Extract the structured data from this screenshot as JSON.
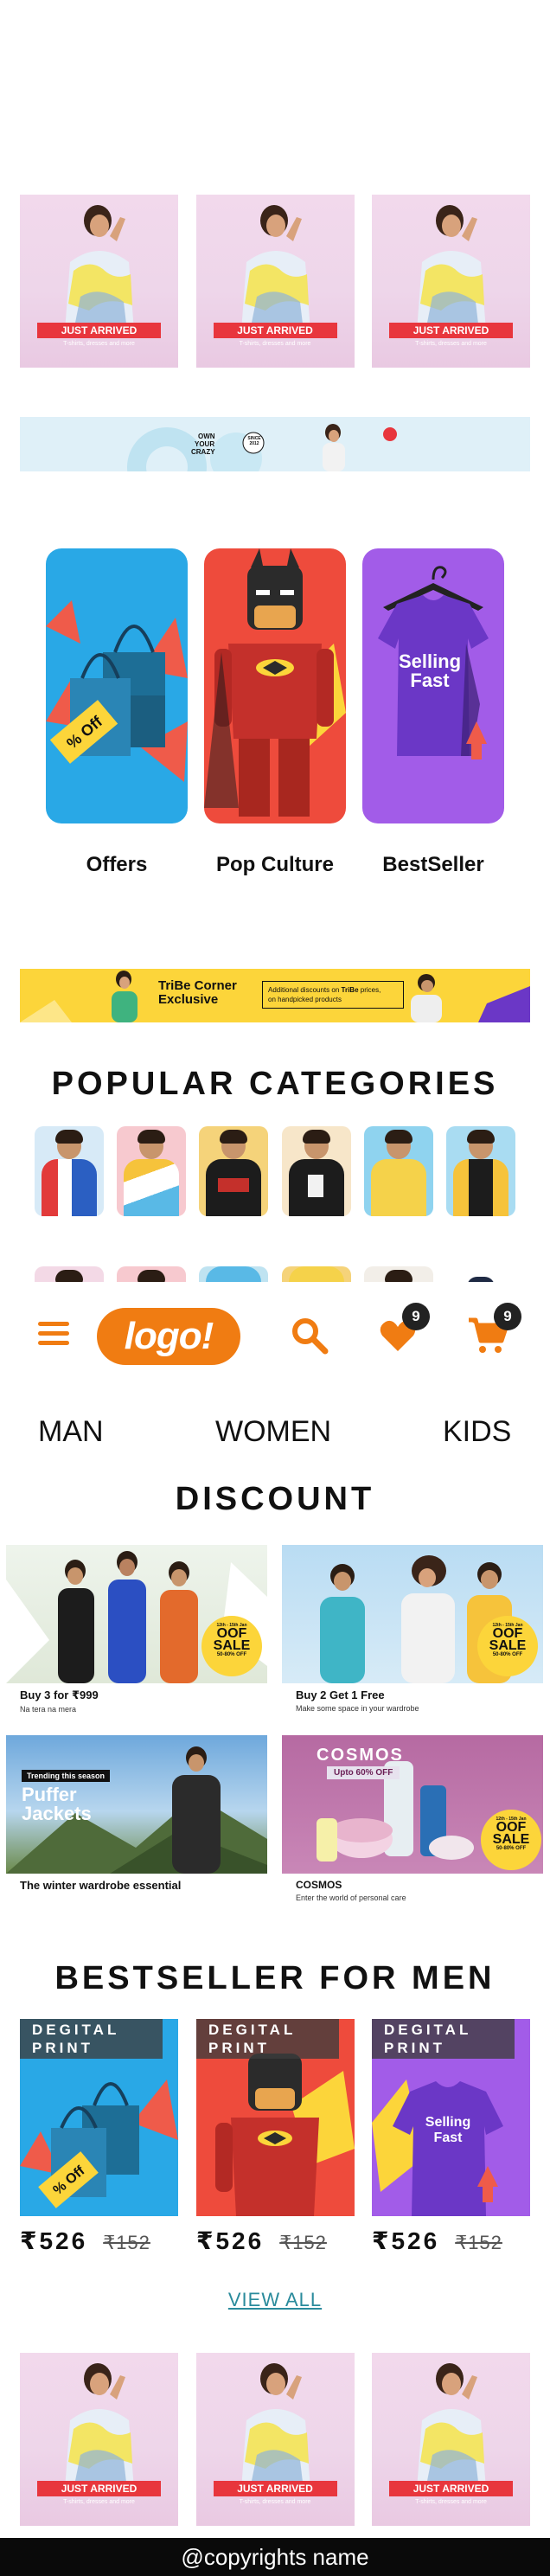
{
  "hero": {
    "badge": "JUST ARRIVED",
    "sub": "T-shirts, dresses and more"
  },
  "promo_strip": {
    "line1": "OWN",
    "line2": "YOUR",
    "line3": "CRAZY",
    "since": "SINCE",
    "year": "2012"
  },
  "tiles": {
    "offers_graphic": "% Off",
    "bestseller_graphic_1": "Selling",
    "bestseller_graphic_2": "Fast",
    "labels": [
      "Offers",
      "Pop Culture",
      "BestSeller"
    ]
  },
  "tribe": {
    "title_1": "TriBe Corner",
    "title_2": "Exclusive",
    "note_1": "Additional discounts on",
    "note_brand": "TriBe",
    "note_2": "prices,",
    "note_3": "on handpicked products"
  },
  "popular": {
    "title": "POPULAR CATEGORIES"
  },
  "nav": {
    "logo": "logo!",
    "wishlist_count": "9",
    "cart_count": "9",
    "genders": [
      "MAN",
      "WOMEN",
      "KIDS"
    ]
  },
  "discount": {
    "title": "DISCOUNT",
    "cards": [
      {
        "title": "Buy 3 for ₹999",
        "sub": "Na tera na mera"
      },
      {
        "title": "Buy 2 Get 1 Free",
        "sub": "Make some space in your wardrobe"
      },
      {
        "title": "The winter wardrobe essential",
        "sub": "",
        "trending": "Trending this season",
        "headline_1": "Puffer",
        "headline_2": "Jackets"
      },
      {
        "title": "COSMOS",
        "sub": "Enter the world of personal care",
        "headline": "COSMOS",
        "upto": "Upto 60% OFF"
      }
    ],
    "sale": {
      "top": "12th - 15th Jan",
      "big_1": "OOF",
      "big_2": "SALE",
      "off": "50-80% OFF"
    }
  },
  "bestseller": {
    "title": "BESTSELLER FOR MEN",
    "tag_1": "DEGITAL",
    "tag_2": "PRINT",
    "products": [
      {
        "price": "₹526",
        "mrp": "₹152"
      },
      {
        "price": "₹526",
        "mrp": "₹152"
      },
      {
        "price": "₹526",
        "mrp": "₹152"
      }
    ],
    "view_all": "VIEW ALL"
  },
  "footer": {
    "text": "@copyrights name"
  },
  "colors": {
    "accent": "#f07c12",
    "sale_yellow": "#fcd53a",
    "link_teal": "#2a8b9c",
    "badge_red": "#e8363d"
  }
}
